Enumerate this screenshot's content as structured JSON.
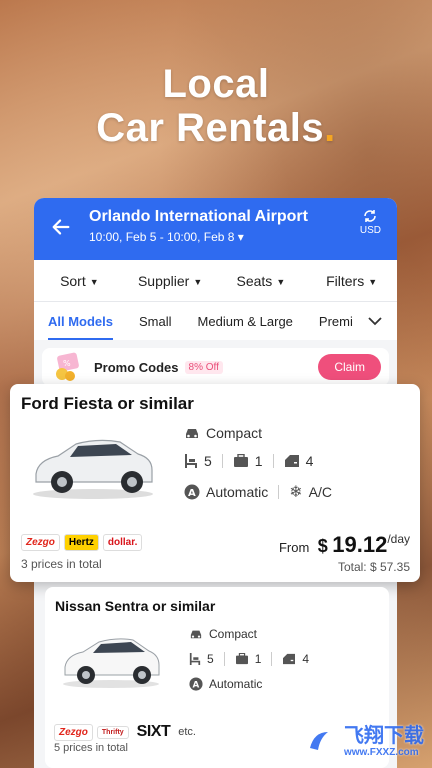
{
  "headline": {
    "line1": "Local",
    "line2": "Car Rentals",
    "dot": "."
  },
  "topbar": {
    "title": "Orlando International Airport",
    "dates": "10:00, Feb 5 - 10:00, Feb 8 ▾",
    "currency": "USD"
  },
  "filters": [
    {
      "label": "Sort"
    },
    {
      "label": "Supplier"
    },
    {
      "label": "Seats"
    },
    {
      "label": "Filters"
    }
  ],
  "tabs": [
    {
      "label": "All Models"
    },
    {
      "label": "Small"
    },
    {
      "label": "Medium & Large"
    },
    {
      "label": "Premiu"
    }
  ],
  "promo": {
    "label": "Promo Codes",
    "discount": "8% Off",
    "claim": "Claim"
  },
  "cards": [
    {
      "title": "Ford Fiesta or similar",
      "category": "Compact",
      "seats": "5",
      "bags": "1",
      "doors": "4",
      "transmission": "Automatic",
      "ac": "A/C",
      "suppliers": [
        "Zezgo",
        "Hertz",
        "dollar."
      ],
      "prices_total": "3 prices in total",
      "from": "From",
      "currency_symbol": "$",
      "price": "19.12",
      "unit": "/day",
      "total": "Total: $ 57.35"
    },
    {
      "title": "Nissan Sentra or similar",
      "category": "Compact",
      "seats": "5",
      "bags": "1",
      "doors": "4",
      "transmission": "Automatic",
      "suppliers": [
        "Zezgo",
        "Thrifty",
        "SIXT"
      ],
      "etc": "etc.",
      "prices_total": "5 prices in total"
    }
  ],
  "watermark": {
    "title": "飞翔下载",
    "url": "www.FXXZ.com"
  },
  "colors": {
    "brand": "#2f6bf0",
    "claim": "#ef4f7c",
    "accent": "#f5a623"
  }
}
